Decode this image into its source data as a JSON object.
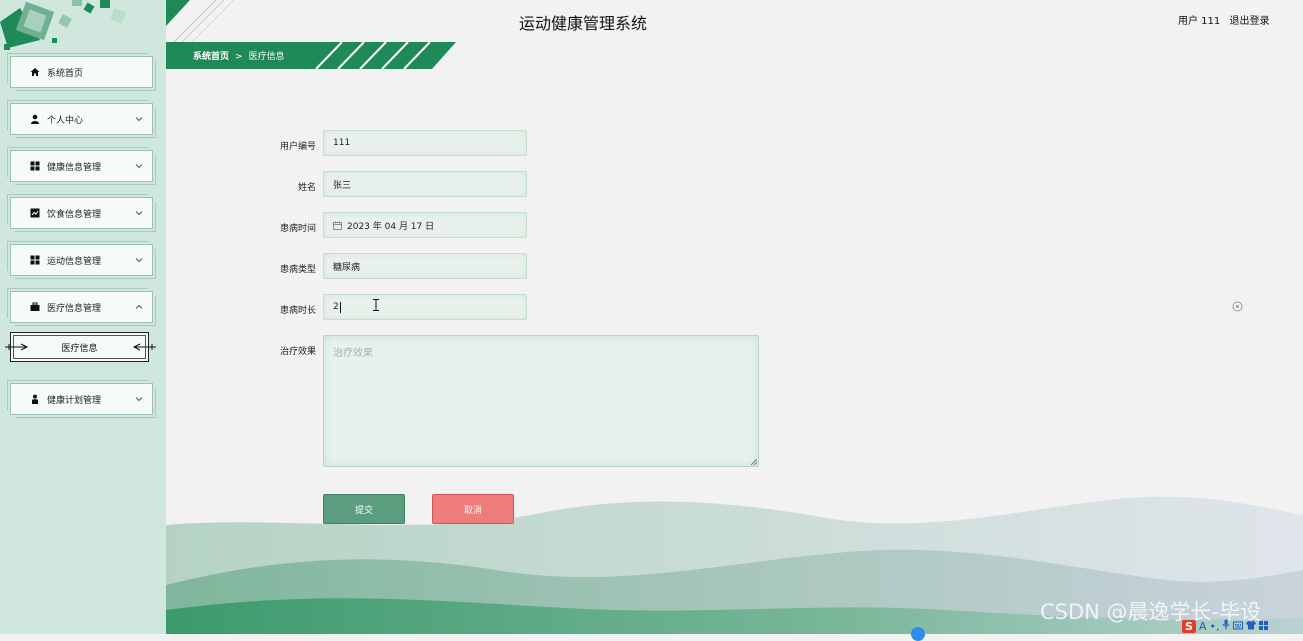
{
  "header": {
    "title": "运动健康管理系统",
    "user_label": "用户 111",
    "logout_label": "退出登录"
  },
  "breadcrumb": {
    "home": "系统首页",
    "separator": ">",
    "current": "医疗信息"
  },
  "sidebar": {
    "items": [
      {
        "label": "系统首页",
        "icon": "home-icon"
      },
      {
        "label": "个人中心",
        "icon": "user-icon"
      },
      {
        "label": "健康信息管理",
        "icon": "grid-icon"
      },
      {
        "label": "饮食信息管理",
        "icon": "chart-icon"
      },
      {
        "label": "运动信息管理",
        "icon": "grid-icon"
      },
      {
        "label": "医疗信息管理",
        "icon": "briefcase-icon"
      },
      {
        "label": "健康计划管理",
        "icon": "person-icon"
      }
    ],
    "submenu": {
      "label": "医疗信息"
    }
  },
  "form": {
    "user_id": {
      "label": "用户编号",
      "value": "111"
    },
    "name": {
      "label": "姓名",
      "value": "张三"
    },
    "onset_time": {
      "label": "患病时间",
      "value": "2023 年 04 月 17 日"
    },
    "disease_type": {
      "label": "患病类型",
      "value": "糖尿病"
    },
    "duration": {
      "label": "患病时长",
      "value": "2"
    },
    "treatment_effect": {
      "label": "治疗效果",
      "placeholder": "治疗效果"
    },
    "submit_label": "提交",
    "cancel_label": "取消"
  },
  "watermark": "CSDN @晨逸学长-毕设",
  "ime": {
    "brand": "S",
    "mode": "A"
  },
  "colors": {
    "primary": "#1f8a57",
    "sidebar_bg": "#cfe7dd",
    "submit": "#5b9e7f",
    "cancel": "#ef7b7b"
  }
}
